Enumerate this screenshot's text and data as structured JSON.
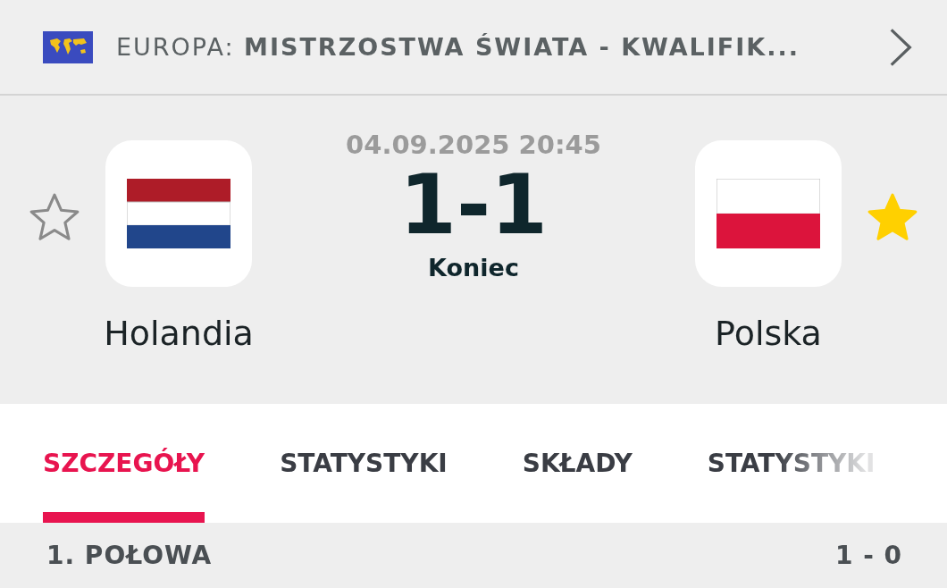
{
  "competition": {
    "region": "EUROPA:",
    "name": "MISTRZOSTWA ŚWIATA - KWALIFIK..."
  },
  "match": {
    "datetime": "04.09.2025 20:45",
    "score": "1-1",
    "status": "Koniec",
    "home": {
      "name": "Holandia",
      "kind": "dutch",
      "favorite": false
    },
    "away": {
      "name": "Polska",
      "kind": "polish",
      "favorite": true
    }
  },
  "tabs": [
    {
      "label": "SZCZEGÓŁY",
      "selected": true
    },
    {
      "label": "STATYSTYKI",
      "selected": false
    },
    {
      "label": "SKŁADY",
      "selected": false
    },
    {
      "label": "STATYSTYKI",
      "selected": false
    }
  ],
  "section": {
    "title": "1. POŁOWA",
    "score": "1 - 0"
  }
}
